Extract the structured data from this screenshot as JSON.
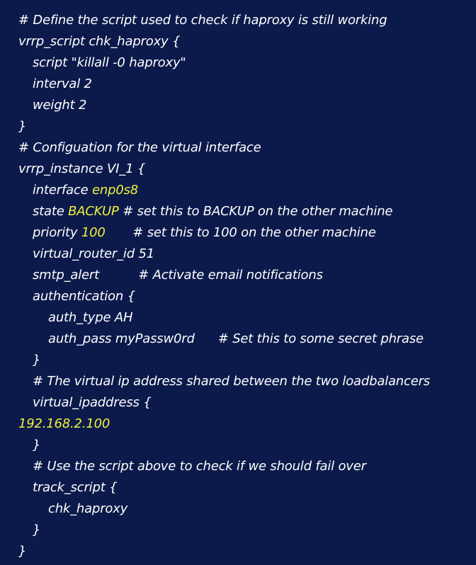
{
  "colors": {
    "background": "#0c1a4b",
    "text": "#ffffff",
    "highlight": "#f1f03d"
  },
  "code_lines": [
    {
      "indent": 0,
      "segments": [
        {
          "text": "# Define the script used to check if haproxy is still working",
          "hl": false
        }
      ]
    },
    {
      "indent": 0,
      "segments": [
        {
          "text": "vrrp_script chk_haproxy {",
          "hl": false
        }
      ]
    },
    {
      "indent": 1,
      "segments": [
        {
          "text": "script \"killall -0 haproxy\"",
          "hl": false
        }
      ]
    },
    {
      "indent": 1,
      "segments": [
        {
          "text": "interval 2",
          "hl": false
        }
      ]
    },
    {
      "indent": 1,
      "segments": [
        {
          "text": "weight 2",
          "hl": false
        }
      ]
    },
    {
      "indent": 0,
      "segments": [
        {
          "text": "}",
          "hl": false
        }
      ]
    },
    {
      "indent": 0,
      "segments": [
        {
          "text": "# Configuation for the virtual interface",
          "hl": false
        }
      ]
    },
    {
      "indent": 0,
      "segments": [
        {
          "text": "vrrp_instance VI_1 {",
          "hl": false
        }
      ]
    },
    {
      "indent": 1,
      "segments": [
        {
          "text": "interface ",
          "hl": false
        },
        {
          "text": "enp0s8",
          "hl": true
        }
      ]
    },
    {
      "indent": 1,
      "segments": [
        {
          "text": "state ",
          "hl": false
        },
        {
          "text": "BACKUP",
          "hl": true
        },
        {
          "text": " # set this to BACKUP on the other machine",
          "hl": false
        }
      ]
    },
    {
      "indent": 1,
      "segments": [
        {
          "text": "priority ",
          "hl": false
        },
        {
          "text": "100",
          "hl": true
        },
        {
          "text": "       # set this to 100 on the other machine",
          "hl": false
        }
      ]
    },
    {
      "indent": 1,
      "segments": [
        {
          "text": "virtual_router_id 51",
          "hl": false
        }
      ]
    },
    {
      "indent": 1,
      "segments": [
        {
          "text": "smtp_alert          # Activate email notifications",
          "hl": false
        }
      ]
    },
    {
      "indent": 1,
      "segments": [
        {
          "text": "authentication {",
          "hl": false
        }
      ]
    },
    {
      "indent": 2,
      "segments": [
        {
          "text": "auth_type AH",
          "hl": false
        }
      ]
    },
    {
      "indent": 2,
      "segments": [
        {
          "text": "auth_pass myPassw0rd      # Set this to some secret phrase",
          "hl": false
        }
      ]
    },
    {
      "indent": 1,
      "segments": [
        {
          "text": "}",
          "hl": false
        }
      ]
    },
    {
      "indent": 1,
      "segments": [
        {
          "text": "# The virtual ip address shared between the two loadbalancers",
          "hl": false
        }
      ]
    },
    {
      "indent": 1,
      "segments": [
        {
          "text": "virtual_ipaddress {",
          "hl": false
        }
      ]
    },
    {
      "indent": "flush",
      "segments": [
        {
          "text": "192.168.2.100",
          "hl": true
        }
      ]
    },
    {
      "indent": 1,
      "segments": [
        {
          "text": "}",
          "hl": false
        }
      ]
    },
    {
      "indent": 1,
      "segments": [
        {
          "text": "# Use the script above to check if we should fail over",
          "hl": false
        }
      ]
    },
    {
      "indent": 1,
      "segments": [
        {
          "text": "track_script {",
          "hl": false
        }
      ]
    },
    {
      "indent": 2,
      "segments": [
        {
          "text": "chk_haproxy",
          "hl": false
        }
      ]
    },
    {
      "indent": 1,
      "segments": [
        {
          "text": "}",
          "hl": false
        }
      ]
    },
    {
      "indent": 0,
      "segments": [
        {
          "text": "}",
          "hl": false
        }
      ]
    }
  ]
}
